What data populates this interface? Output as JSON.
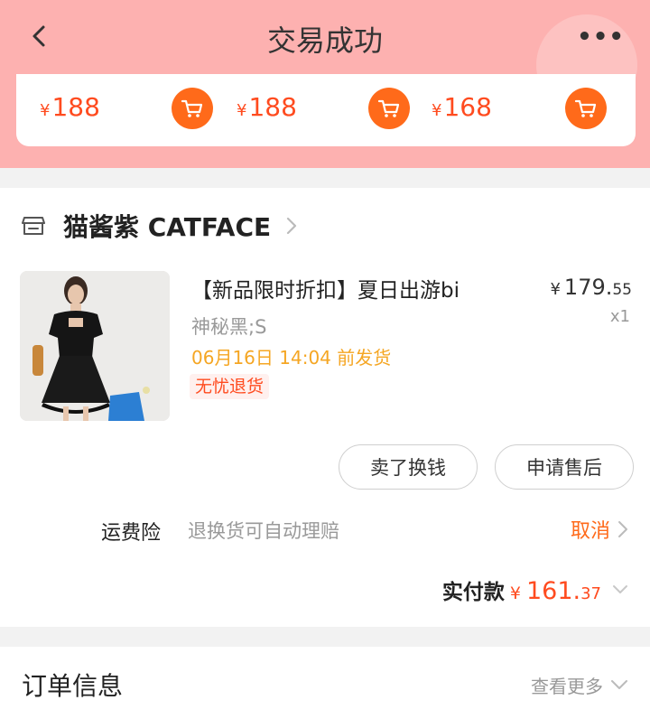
{
  "header": {
    "title": "交易成功",
    "back_icon": "chevron-left-icon",
    "more_label": "•••"
  },
  "recommendations": [
    {
      "yen": "¥",
      "price": "188",
      "icon": "cart-icon"
    },
    {
      "yen": "¥",
      "price": "188",
      "icon": "cart-icon"
    },
    {
      "yen": "¥",
      "price": "168",
      "icon": "cart-icon"
    }
  ],
  "shop": {
    "icon": "store-icon",
    "name": "猫酱紫 CATFACE"
  },
  "product": {
    "title": "【新品限时折扣】夏日出游bi",
    "sku": "神秘黑;S",
    "ship_time": "06月16日 14:04 前发货",
    "tag": "无忧退货",
    "price_yen": "¥",
    "price_int": "179.",
    "price_dec": "55",
    "qty": "x1"
  },
  "actions": {
    "sell_label": "卖了换钱",
    "after_sale_label": "申请售后"
  },
  "insurance": {
    "label": "运费险",
    "desc": "退换货可自动理赔",
    "cancel": "取消"
  },
  "payment": {
    "label": "实付款",
    "yen": "¥",
    "amount_int": "161.",
    "amount_dec": "37"
  },
  "order_info": {
    "title": "订单信息",
    "more": "查看更多"
  },
  "colors": {
    "header_bg": "#fdb1b0",
    "accent": "#ff6a1a",
    "price": "#ff4b1f",
    "ship_time": "#f5a623"
  }
}
